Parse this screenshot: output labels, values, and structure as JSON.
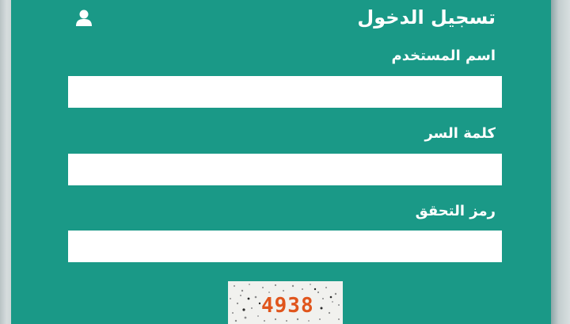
{
  "login": {
    "title": "تسجيل الدخول",
    "user_icon": "user-icon",
    "username_label": "اسم المستخدم",
    "username_value": "",
    "password_label": "كلمة السر",
    "password_value": "",
    "captcha_label": "رمز التحقق",
    "captcha_value": "",
    "captcha_code": "4938"
  },
  "colors": {
    "panel_bg": "#1a9987",
    "text": "#ffffff",
    "input_bg": "#ffffff",
    "captcha_text": "#e0551c"
  }
}
